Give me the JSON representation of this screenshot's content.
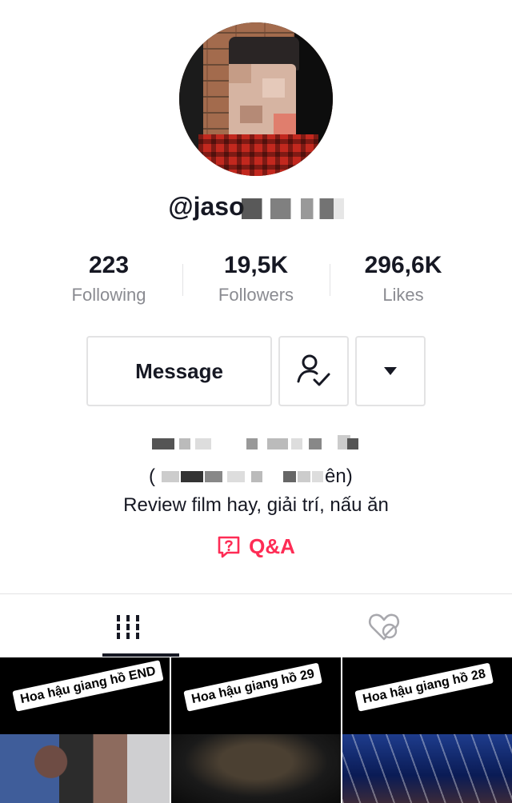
{
  "profile": {
    "username_visible": "@jaso",
    "bio_line": "Review film hay, giải trí, nấu ăn",
    "bio_paren_open": "(",
    "bio_paren_tail": "ên)"
  },
  "stats": [
    {
      "value": "223",
      "label": "Following"
    },
    {
      "value": "19,5K",
      "label": "Followers"
    },
    {
      "value": "296,6K",
      "label": "Likes"
    }
  ],
  "actions": {
    "message_label": "Message",
    "follow_icon": "user-check-icon",
    "more_icon": "caret-down-icon"
  },
  "qa": {
    "label": "Q&A",
    "icon": "question-chat-icon",
    "color": "#fe2c55"
  },
  "tabs": [
    {
      "icon": "grid-icon",
      "active": true
    },
    {
      "icon": "liked-hidden-icon",
      "active": false
    }
  ],
  "videos": [
    {
      "caption": "Hoa hậu giang hồ END"
    },
    {
      "caption": "Hoa hậu giang hồ 29"
    },
    {
      "caption": "Hoa hậu giang hồ 28"
    }
  ]
}
